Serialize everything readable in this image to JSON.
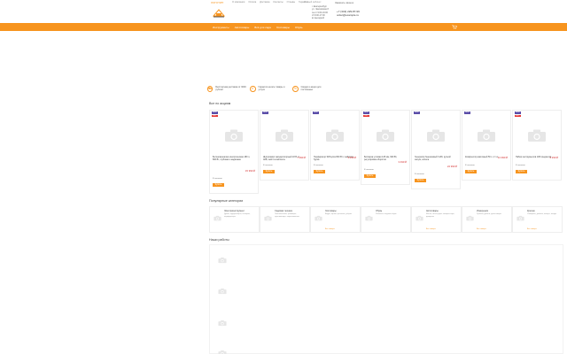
{
  "header": {
    "logo_small": "ЛОГОТИП",
    "top_links": [
      "О компании",
      "Оплата",
      "Доставка",
      "Контакты",
      "Отзывы",
      "Гарантия"
    ],
    "cabinet": "Личный кабинет",
    "address_lines": [
      "г. Екатеринбург",
      "ул. Чкаловская 8",
      "пн-пт 9:00-19:00",
      "сб 9:00-17:00",
      "вс выходной"
    ],
    "phones": [
      "+7 (343) 229-87-99",
      "order@example.ru"
    ],
    "callback": "Заказать звонок"
  },
  "nav": {
    "items": [
      "Инструменты",
      "Автотовары",
      "Всё для сада",
      "Хозтовары",
      "Обувь"
    ],
    "cart_icon": "cart-icon"
  },
  "features": [
    {
      "text": "Бесплатная доставка от 3000 рублей",
      "icon": "truck-icon"
    },
    {
      "text": "Гарантия на все товары и услуги",
      "icon": "shield-icon"
    },
    {
      "text": "Скидки и акции для постоянных",
      "icon": "percent-icon"
    }
  ],
  "sections": {
    "sale_title": "Все по акциям",
    "cats_title": "Популярные категории",
    "works_title": "Наши работы"
  },
  "products": [
    {
      "badges": [
        "NEW",
        "-5%"
      ],
      "name": "Бетономешалка электрическая 180 л, 800 Вт, глубокая и надёжная",
      "price": "15 990 ₽",
      "avail": "В наличии",
      "buy": "Купить"
    },
    {
      "badges": [
        "NEW"
      ],
      "name": "Шуруповёрт аккумуляторный 18 В, 2 АКБ, кейс в комплекте",
      "price": "7 990 ₽",
      "avail": "В наличии",
      "buy": "Купить"
    },
    {
      "badges": [
        "NEW"
      ],
      "name": "Перфоратор SDS-plus 800 Вт с набором буров",
      "price": "5 490 ₽",
      "avail": "В наличии",
      "buy": "Купить"
    },
    {
      "badges": [
        "NEW",
        "-7%"
      ],
      "name": "Болгарка угловая 125 мм, 900 Вт, регулировка оборотов",
      "price": "3 490 ₽",
      "avail": "В наличии",
      "buy": "Купить"
    },
    {
      "badges": [
        "NEW"
      ],
      "name": "Генератор бензиновый 3 кВт, ручной запуск, колёса",
      "price": "24 990 ₽",
      "avail": "В наличии",
      "buy": "Купить"
    },
    {
      "badges": [
        "NEW"
      ],
      "name": "Компрессор масляный 50 л, 2 л.с.",
      "price": "13 990 ₽",
      "avail": "В наличии",
      "buy": "Купить"
    },
    {
      "badges": [
        "NEW",
        "-9%"
      ],
      "name": "Набор инструментов 108 предметов",
      "price": "4 290 ₽",
      "avail": "В наличии",
      "buy": "Купить"
    }
  ],
  "categories": [
    {
      "title": "Электроинструмент",
      "sub": "Дрели, шуруповёрты, болгарки, перфораторы",
      "more": ""
    },
    {
      "title": "Садовая техника",
      "sub": "Газонокосилки, триммеры, культиваторы, опрыскиватели",
      "more": ""
    },
    {
      "title": "Хозтовары",
      "sub": "Ведра, щетки, хранение, уборка",
      "more": "Все товары"
    },
    {
      "title": "Обувь",
      "sub": "Рабочая и садовая обувь",
      "more": ""
    },
    {
      "title": "Автотовары",
      "sub": "Масла, аксессуары, компрессоры, домкраты",
      "more": "Все товары"
    },
    {
      "title": "Измерения",
      "sub": "Рулетки, уровни, дальномеры",
      "more": "Все товары"
    },
    {
      "title": "Крепеж",
      "sub": "Саморезы, дюбели, анкеры, гвозди",
      "more": "Все товары"
    }
  ]
}
